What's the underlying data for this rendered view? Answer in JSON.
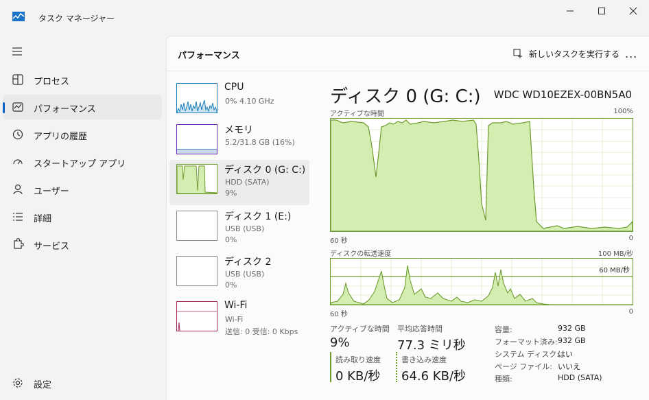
{
  "app": {
    "title": "タスク マネージャー"
  },
  "nav": {
    "items": [
      {
        "label": "プロセス"
      },
      {
        "label": "パフォーマンス"
      },
      {
        "label": "アプリの履歴"
      },
      {
        "label": "スタートアップ アプリ"
      },
      {
        "label": "ユーザー"
      },
      {
        "label": "詳細"
      },
      {
        "label": "サービス"
      }
    ],
    "settings_label": "設定"
  },
  "header": {
    "title": "パフォーマンス",
    "run_task_label": "新しいタスクを実行する",
    "more_label": "..."
  },
  "devices": [
    {
      "name": "CPU",
      "sub1": "0%  4.10 GHz",
      "sub2": ""
    },
    {
      "name": "メモリ",
      "sub1": "5.2/31.8 GB (16%)",
      "sub2": ""
    },
    {
      "name": "ディスク 0 (G: C:)",
      "sub1": "HDD (SATA)",
      "sub2": "9%"
    },
    {
      "name": "ディスク 1 (E:)",
      "sub1": "USB (USB)",
      "sub2": "0%"
    },
    {
      "name": "ディスク 2",
      "sub1": "USB (USB)",
      "sub2": "0%"
    },
    {
      "name": "Wi-Fi",
      "sub1": "Wi-Fi",
      "sub2": "送信: 0 受信: 0 Kbps"
    }
  ],
  "detail": {
    "title": "ディスク 0 (G: C:)",
    "model": "WDC WD10EZEX-00BN5A0",
    "graph1": {
      "label": "アクティブな時間",
      "max": "100%",
      "time": "60 秒",
      "zero": "0"
    },
    "graph2": {
      "label": "ディスクの転送速度",
      "max": "100 MB/秒",
      "line_label": "60 MB/秒",
      "time": "60 秒",
      "zero": "0"
    },
    "stats": {
      "active_label": "アクティブな時間",
      "active_value": "9%",
      "resp_label": "平均応答時間",
      "resp_value": "77.3 ミリ秒",
      "read_label": "読み取り速度",
      "read_value": "0 KB/秒",
      "write_label": "書き込み速度",
      "write_value": "64.6 KB/秒"
    },
    "props": [
      {
        "k": "容量:",
        "v": "932 GB"
      },
      {
        "k": "フォーマット済み:",
        "v": "932 GB"
      },
      {
        "k": "システム ディスク:",
        "v": "はい"
      },
      {
        "k": "ページ ファイル:",
        "v": "いいえ"
      },
      {
        "k": "種類:",
        "v": "HDD (SATA)"
      }
    ]
  },
  "colors": {
    "accent": "#0a63c9",
    "disk_line": "#6d9a2e",
    "disk_fill": "#d4eeb1",
    "cpu": "#1a7bb9",
    "mem": "#6e2bb1",
    "wifi": "#a7265c"
  }
}
